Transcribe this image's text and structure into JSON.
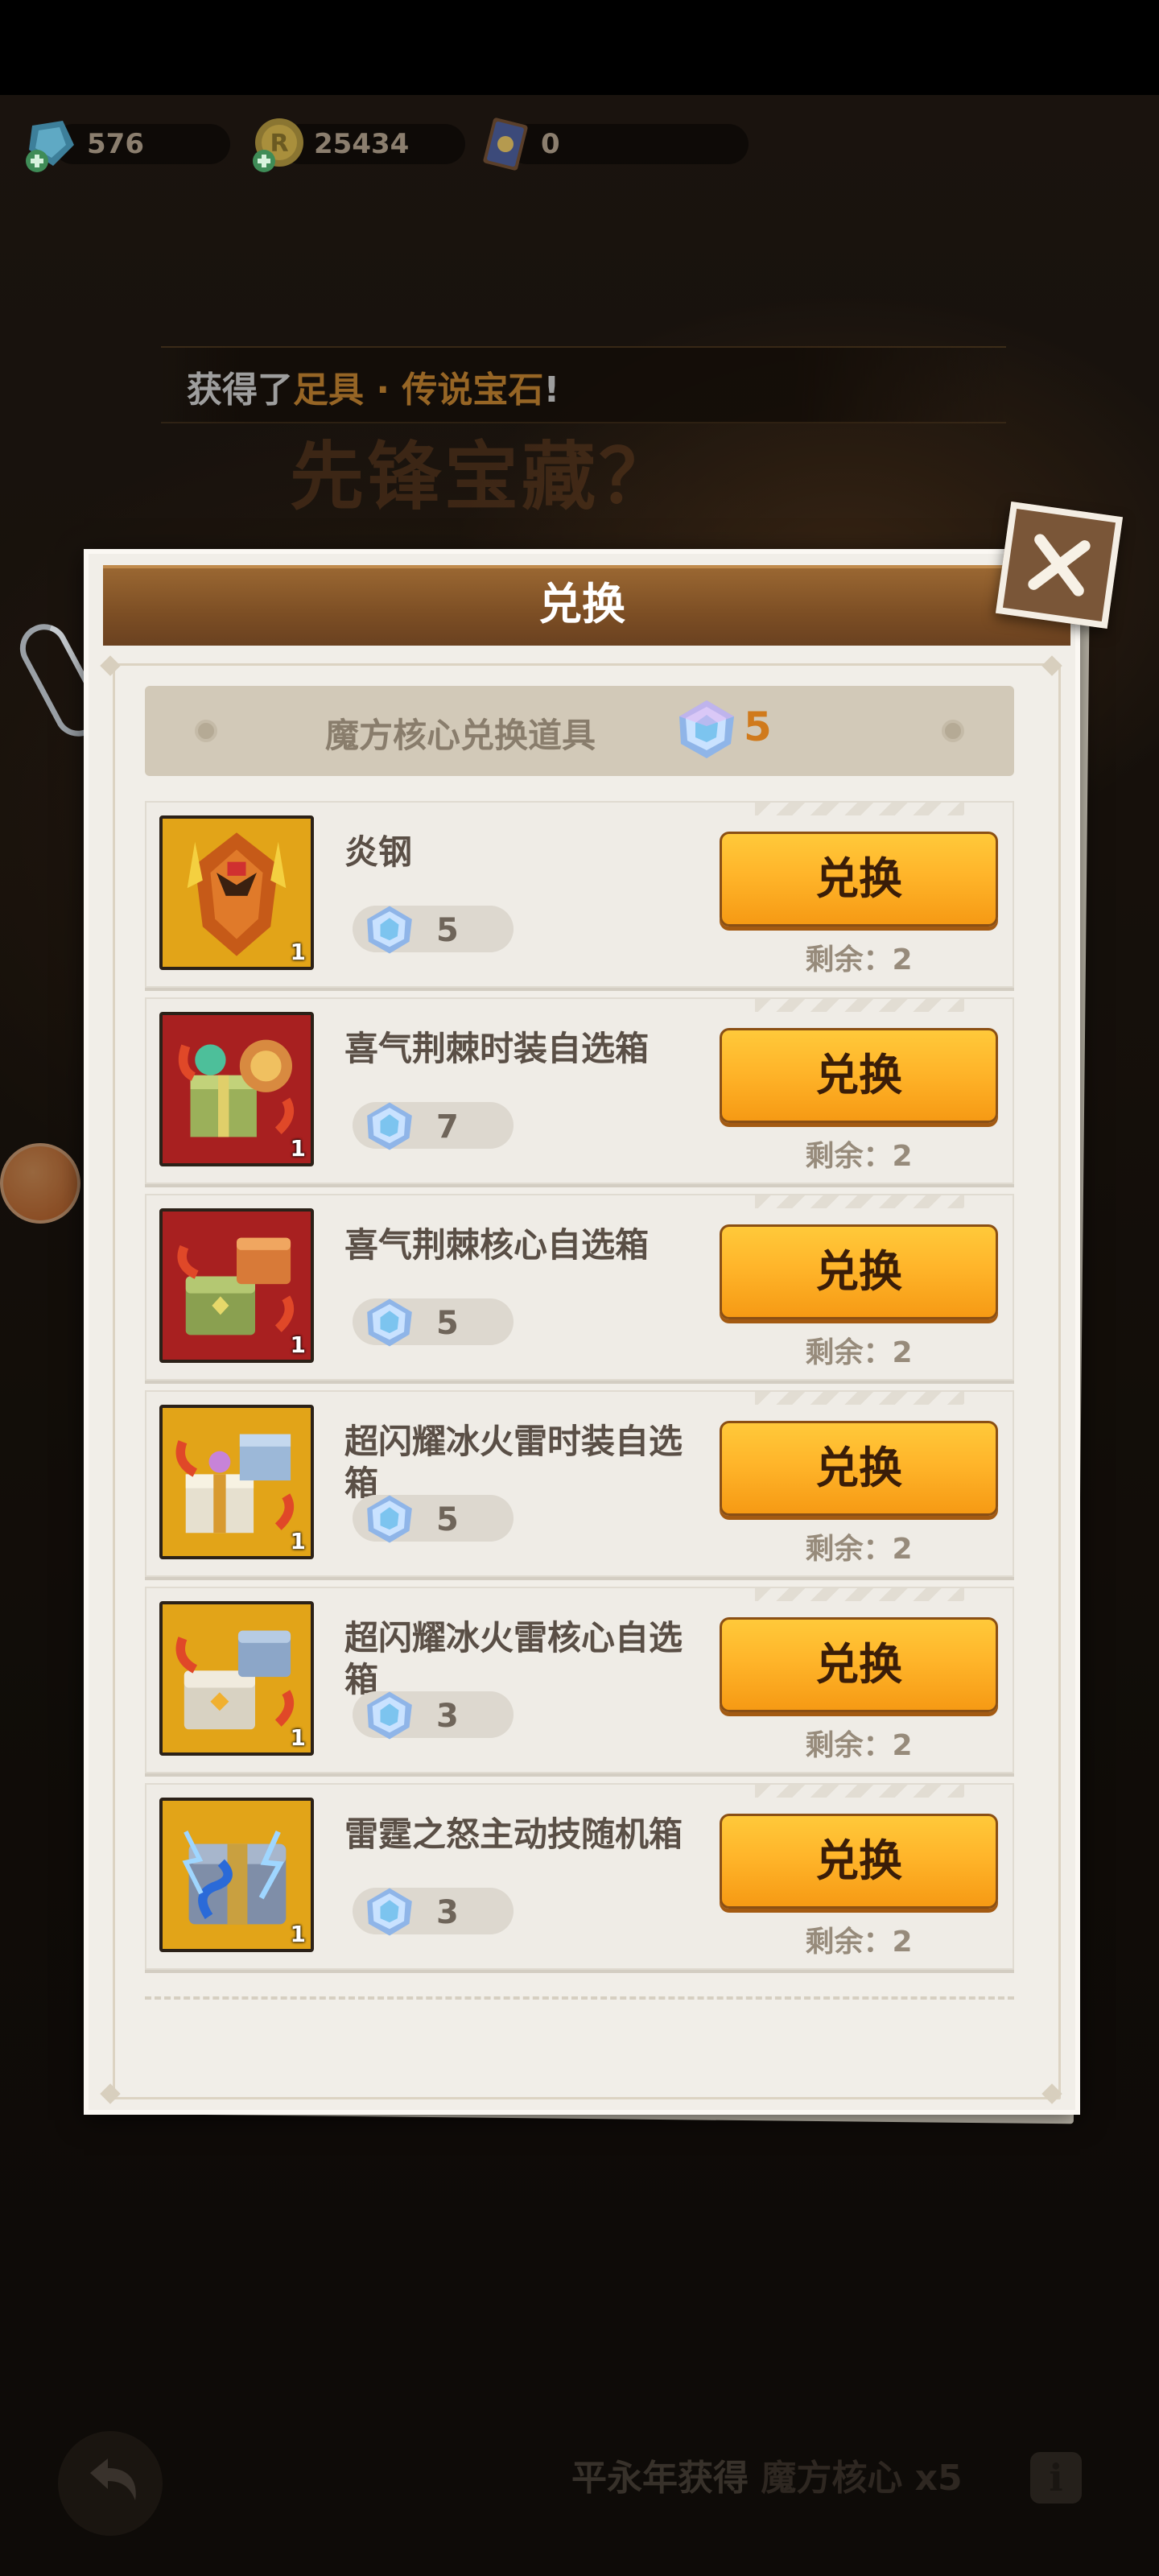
{
  "currency": [
    {
      "name": "gem",
      "value": "576"
    },
    {
      "name": "coin",
      "value": "25434"
    },
    {
      "name": "card",
      "value": "0"
    }
  ],
  "notice": {
    "prefix": "获得了",
    "highlight": "足具 · 传说宝石",
    "suffix": "!"
  },
  "event_title": "先锋宝藏？",
  "dialog": {
    "title": "兑换",
    "subheader": {
      "label": "魔方核心兑换道具",
      "count": "5"
    }
  },
  "items": [
    {
      "name": "炎钢",
      "cost": "5",
      "button": "兑换",
      "remaining": "剩余：2",
      "qty": "1"
    },
    {
      "name": "喜气荆棘时装自选箱",
      "cost": "7",
      "button": "兑换",
      "remaining": "剩余：2",
      "qty": "1"
    },
    {
      "name": "喜气荆棘核心自选箱",
      "cost": "5",
      "button": "兑换",
      "remaining": "剩余：2",
      "qty": "1"
    },
    {
      "name": "超闪耀冰火雷时装自选箱",
      "cost": "5",
      "button": "兑换",
      "remaining": "剩余：2",
      "qty": "1"
    },
    {
      "name": "超闪耀冰火雷核心自选箱",
      "cost": "3",
      "button": "兑换",
      "remaining": "剩余：2",
      "qty": "1"
    },
    {
      "name": "雷霆之怒主动技随机箱",
      "cost": "3",
      "button": "兑换",
      "remaining": "剩余：2",
      "qty": "1"
    }
  ],
  "bottom": {
    "text": "平永年获得",
    "reward": "魔方核心 x5",
    "info": "i"
  },
  "colors": {
    "button": "#ffb52a",
    "accent": "#d07a1c",
    "header": "#7c4e24"
  }
}
